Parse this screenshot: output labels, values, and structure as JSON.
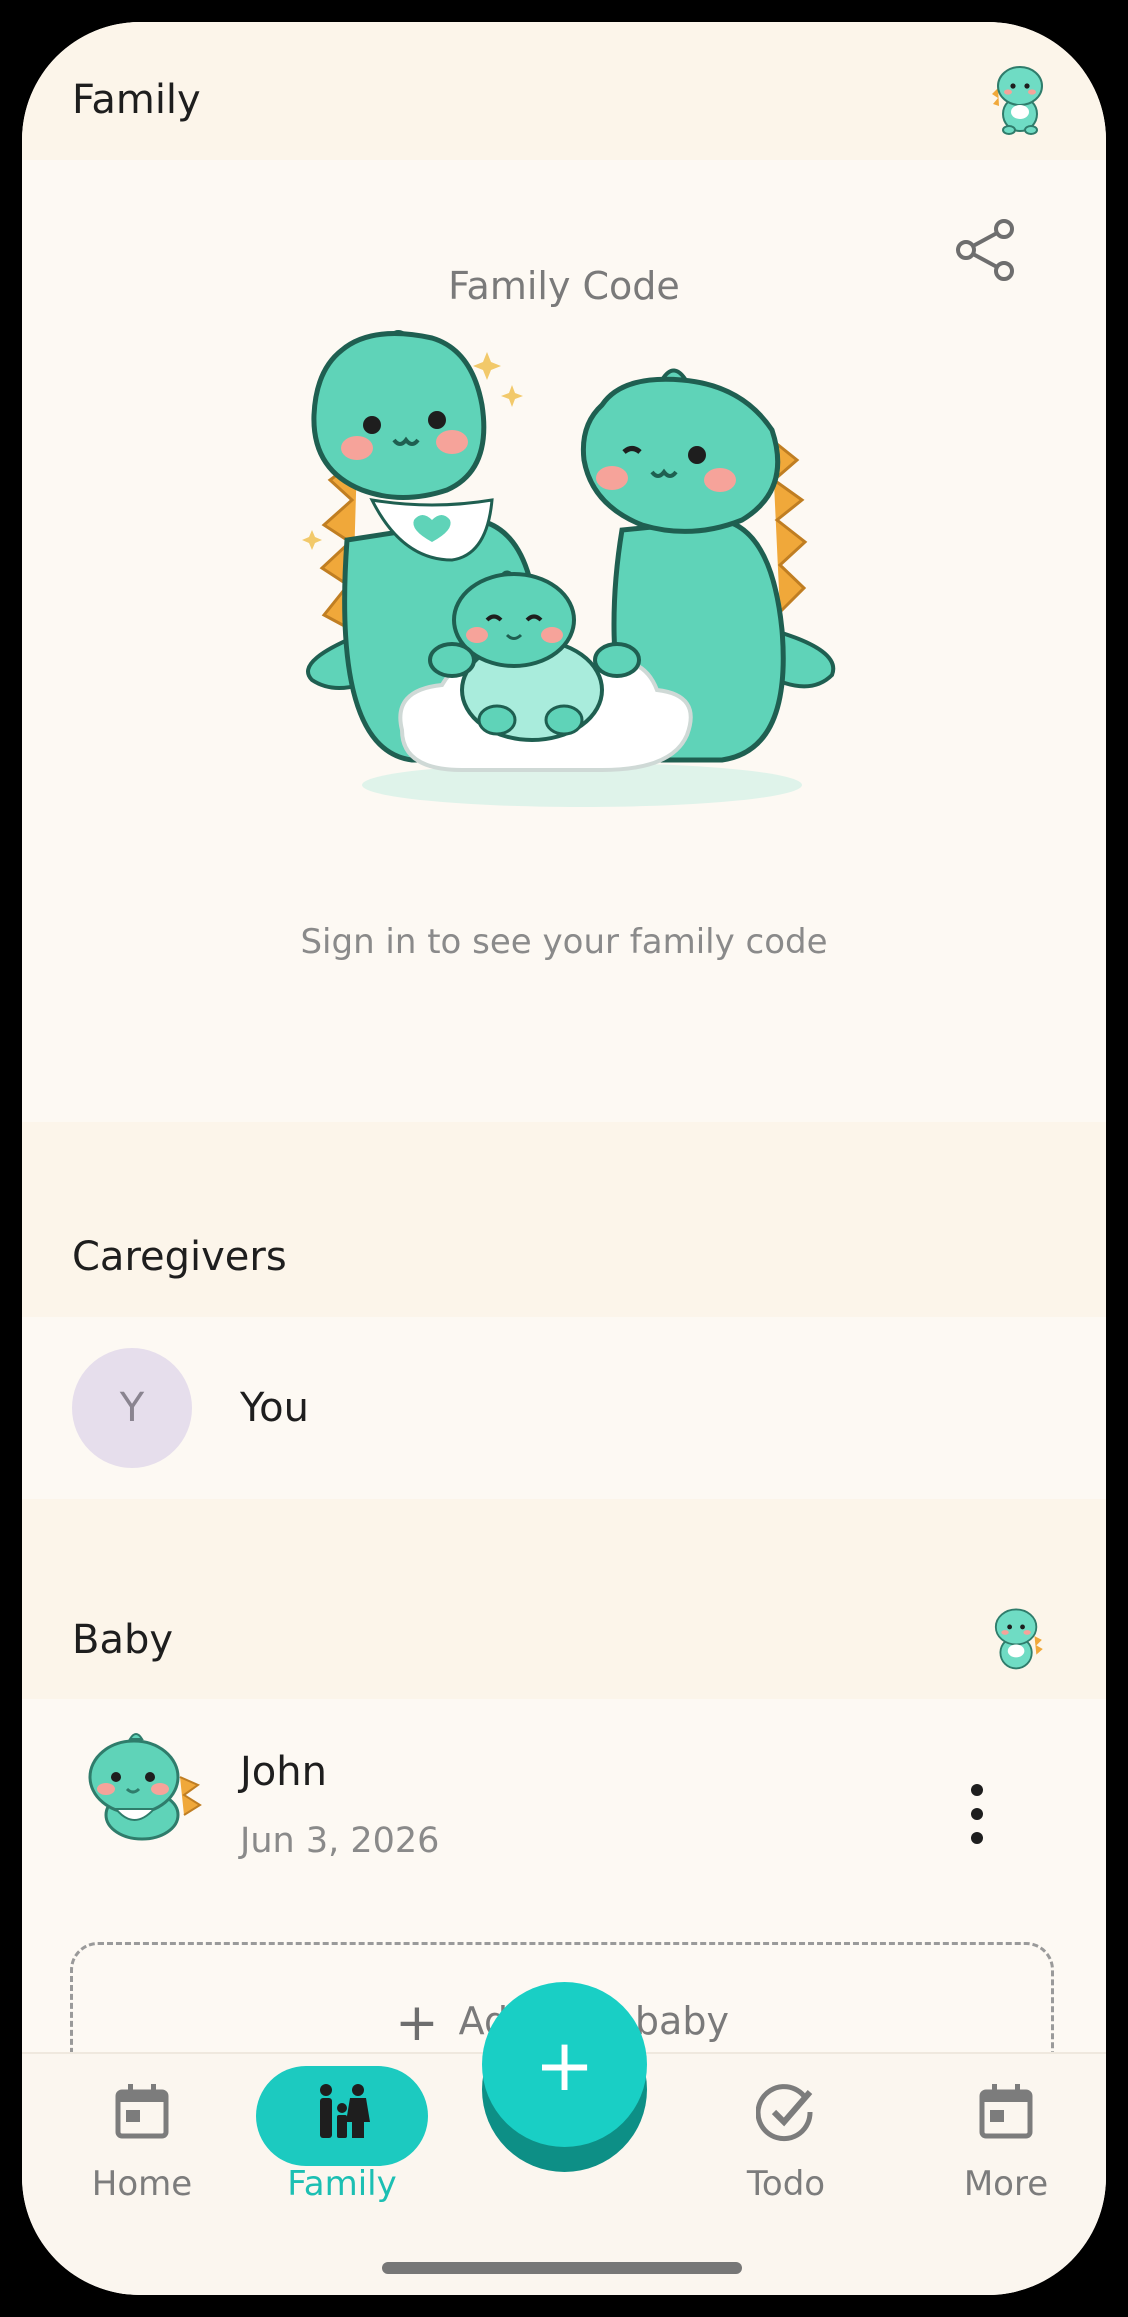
{
  "header": {
    "title": "Family"
  },
  "family_code": {
    "title": "Family Code",
    "hint": "Sign in to see your family code"
  },
  "caregivers": {
    "title": "Caregivers",
    "items": [
      {
        "initial": "Y",
        "name": "You"
      }
    ]
  },
  "baby": {
    "title": "Baby",
    "items": [
      {
        "name": "John",
        "date": "Jun 3, 2026"
      }
    ],
    "add_label": "Add new baby"
  },
  "fab_label": "+",
  "nav": {
    "items": [
      {
        "label": "Home",
        "icon": "calendar-icon"
      },
      {
        "label": "Family",
        "icon": "family-icon",
        "active": true
      },
      {
        "label": "Todo",
        "icon": "check-circle-icon"
      },
      {
        "label": "More",
        "icon": "calendar-icon"
      }
    ]
  },
  "colors": {
    "accent": "#19cfc5",
    "background": "#fdf9f3",
    "section_background": "#fcf5ea",
    "dino": "#5fd3b8"
  }
}
